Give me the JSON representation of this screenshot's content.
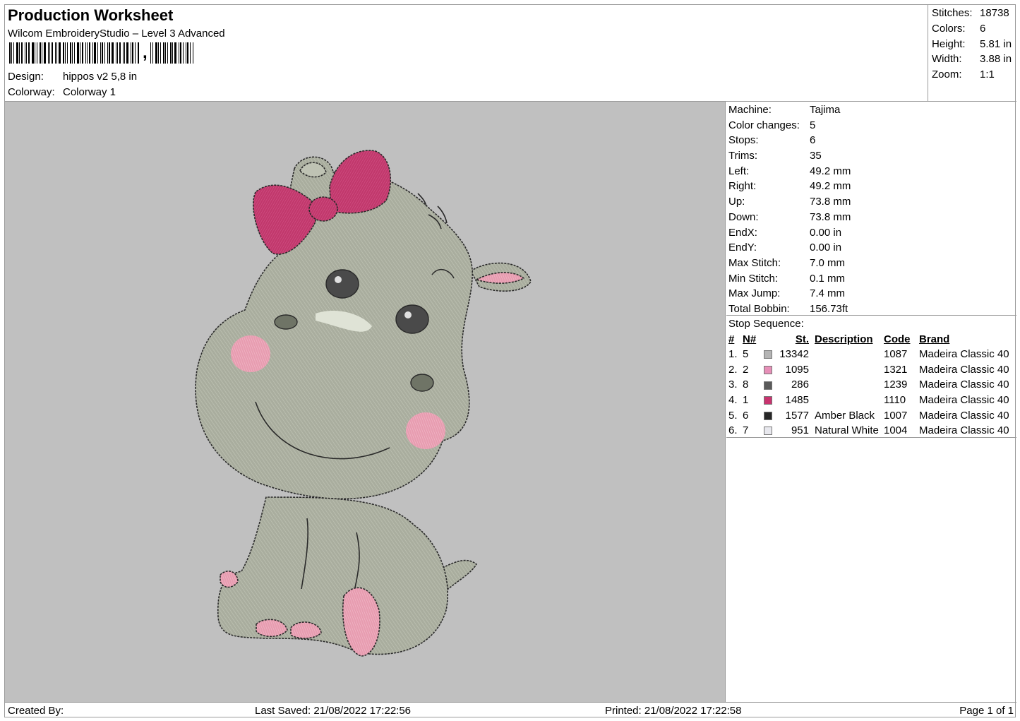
{
  "header": {
    "title": "Production Worksheet",
    "subtitle": "Wilcom EmbroideryStudio – Level 3 Advanced",
    "barcode_suffix": ",",
    "design_label": "Design:",
    "design_value": "hippos v2 5,8 in",
    "colorway_label": "Colorway:",
    "colorway_value": "Colorway 1"
  },
  "summary": [
    {
      "label": "Stitches:",
      "value": "18738"
    },
    {
      "label": "Colors:",
      "value": "6"
    },
    {
      "label": "Height:",
      "value": "5.81 in"
    },
    {
      "label": "Width:",
      "value": "3.88 in"
    },
    {
      "label": "Zoom:",
      "value": "1:1"
    }
  ],
  "machine": [
    {
      "label": "Machine:",
      "value": "Tajima"
    },
    {
      "label": "Color changes:",
      "value": "5"
    },
    {
      "label": "Stops:",
      "value": "6"
    },
    {
      "label": "Trims:",
      "value": "35"
    },
    {
      "label": "Left:",
      "value": "49.2 mm"
    },
    {
      "label": "Right:",
      "value": "49.2 mm"
    },
    {
      "label": "Up:",
      "value": "73.8 mm"
    },
    {
      "label": "Down:",
      "value": "73.8 mm"
    },
    {
      "label": "EndX:",
      "value": "0.00 in"
    },
    {
      "label": "EndY:",
      "value": "0.00 in"
    },
    {
      "label": "Max Stitch:",
      "value": "7.0 mm"
    },
    {
      "label": "Min Stitch:",
      "value": "0.1 mm"
    },
    {
      "label": "Max Jump:",
      "value": "7.4 mm"
    },
    {
      "label": "Total Bobbin:",
      "value": "156.73ft"
    }
  ],
  "stop_sequence": {
    "caption": "Stop Sequence:",
    "headers": {
      "idx": "#",
      "n": "N#",
      "st": "St.",
      "desc": "Description",
      "code": "Code",
      "brand": "Brand"
    },
    "rows": [
      {
        "idx": "1.",
        "n": "5",
        "color": "#b4b4b4",
        "st": "13342",
        "desc": "",
        "code": "1087",
        "brand": "Madeira Classic 40"
      },
      {
        "idx": "2.",
        "n": "2",
        "color": "#e78fb8",
        "st": "1095",
        "desc": "",
        "code": "1321",
        "brand": "Madeira Classic 40"
      },
      {
        "idx": "3.",
        "n": "8",
        "color": "#5a5a5a",
        "st": "286",
        "desc": "",
        "code": "1239",
        "brand": "Madeira Classic 40"
      },
      {
        "idx": "4.",
        "n": "1",
        "color": "#c9336f",
        "st": "1485",
        "desc": "",
        "code": "1110",
        "brand": "Madeira Classic 40"
      },
      {
        "idx": "5.",
        "n": "6",
        "color": "#262626",
        "st": "1577",
        "desc": "Amber Black",
        "code": "1007",
        "brand": "Madeira Classic 40"
      },
      {
        "idx": "6.",
        "n": "7",
        "color": "#e8e8ee",
        "st": "951",
        "desc": "Natural White",
        "code": "1004",
        "brand": "Madeira Classic 40"
      }
    ]
  },
  "footer": {
    "created_by": "Created By:",
    "last_saved": "Last Saved: 21/08/2022 17:22:56",
    "printed": "Printed: 21/08/2022 17:22:58",
    "page": "Page 1 of 1"
  },
  "colors": {
    "canvas_bg": "#c0c0c0",
    "body": "#a7ab9c",
    "bow": "#c73a6e",
    "pink": "#e8a0b0",
    "outline": "#2a2a2a"
  }
}
